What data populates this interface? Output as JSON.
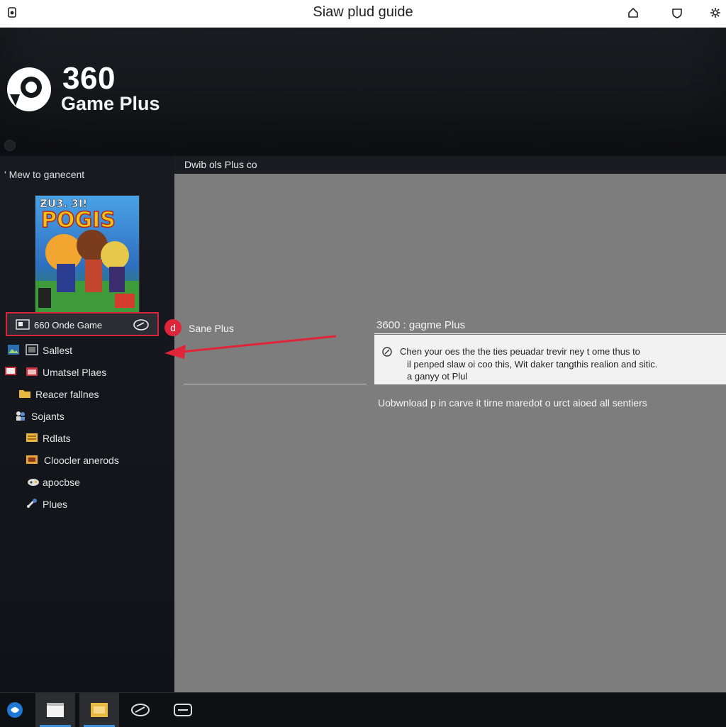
{
  "window": {
    "title": "Siaw plud guide",
    "icons": [
      "app-icon",
      "home-icon",
      "shield-icon",
      "settings-icon"
    ]
  },
  "hero": {
    "logo_title": "360",
    "logo_subtitle": "Game Plus"
  },
  "sidebar": {
    "heading": "' Mew to ganecent",
    "selected_item": {
      "label": "660 Onde Game",
      "icon_left": "monitor-icon",
      "icon_right": "gamepad-icon"
    },
    "items": [
      {
        "label": "Sallest",
        "icon": "image-icon"
      },
      {
        "label": "Umatsel Plaes",
        "icon": "folder-icon"
      },
      {
        "label": "Reacer fallnes",
        "icon": "folder-icon"
      },
      {
        "label": "Sojants",
        "icon": "people-icon"
      },
      {
        "label": "Rdlats",
        "icon": "folder-icon"
      },
      {
        "label": "Cloocler anerods",
        "icon": "folder-icon"
      },
      {
        "label": "apocbse",
        "icon": "gamepad-icon"
      },
      {
        "label": "Plues",
        "icon": "tools-icon"
      }
    ]
  },
  "content": {
    "tab_label": "Dwib ols Plus co",
    "badge": "d",
    "badge_text": "Sane Plus",
    "info_heading": "3600 : gagme Plus",
    "info_lines": [
      "Chen your oes the the ties peuadar trevir ney t ome thus to",
      "il penped slaw oi coo this, Wit daker tangthis realion and sitic.",
      "a ganyy ot Plul"
    ],
    "download_text": "Uobwnload p in carve it tirne maredot o urct aioed all sentiers"
  },
  "taskbar": {
    "buttons": [
      "start-icon",
      "window-icon",
      "folder-icon",
      "gamepad-icon",
      "controller-icon"
    ]
  },
  "colors": {
    "accent_red": "#d6243c",
    "content_gray": "#7d7d7d",
    "sidebar_dark": "#12141a",
    "taskbar_active": "#3d8ed9"
  }
}
